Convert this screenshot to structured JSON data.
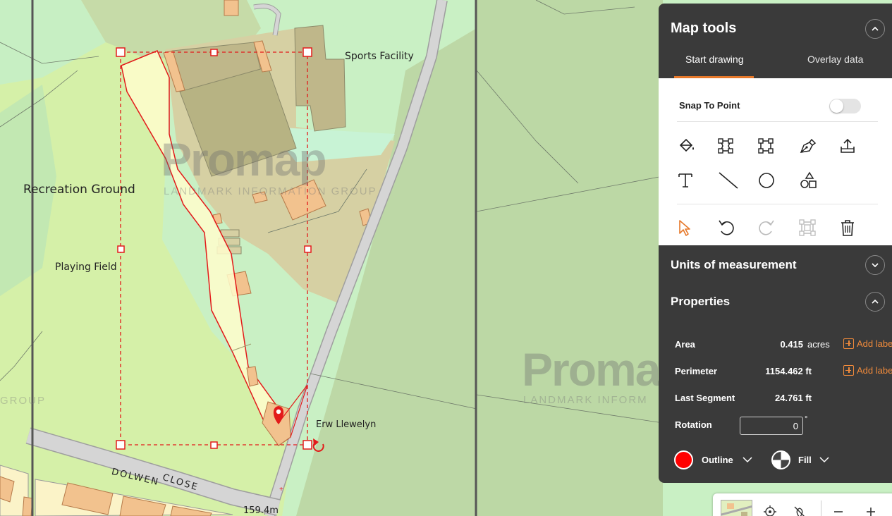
{
  "map": {
    "labels": {
      "recreation_ground": "Recreation Ground",
      "playing_field": "Playing Field",
      "sports_facility": "Sports Facility",
      "erw_llewelyn": "Erw Llewelyn",
      "dolwen": "DOLWEN",
      "close": "CLOSE",
      "spot_height": "159.4m"
    },
    "watermark": {
      "brand": "Promap",
      "tagline": "LANDMARK INFORMATION GROUP",
      "partial_brand": "Promap",
      "partial_tagline": "LANDMARK INFORM",
      "edge_tagline": "GROUP"
    }
  },
  "panel": {
    "title": "Map tools",
    "tabs": [
      {
        "label": "Start drawing",
        "active": true
      },
      {
        "label": "Overlay data",
        "active": false
      }
    ],
    "snap": {
      "label": "Snap To Point",
      "enabled": false
    },
    "tools": {
      "row1": [
        "paint-bucket-icon",
        "polygon-nodes-icon",
        "rectangle-icon",
        "pen-icon",
        "upload-icon"
      ],
      "row2": [
        "text-icon",
        "line-icon",
        "circle-icon",
        "shapes-icon"
      ],
      "row3": [
        "pointer-icon",
        "undo-icon",
        "redo-icon",
        "bounding-box-icon",
        "trash-icon"
      ]
    },
    "units_title": "Units of measurement",
    "properties_title": "Properties",
    "properties": {
      "area": {
        "label": "Area",
        "value": "0.415",
        "unit": "acres",
        "action": "Add label"
      },
      "perimeter": {
        "label": "Perimeter",
        "value": "1154.462 ft",
        "action": "Add label"
      },
      "last_segment": {
        "label": "Last Segment",
        "value": "24.761 ft"
      },
      "rotation": {
        "label": "Rotation",
        "value": "0",
        "degree": "°"
      }
    },
    "style": {
      "outline_label": "Outline",
      "outline_color": "#ff0000",
      "fill_label": "Fill"
    }
  },
  "colors": {
    "accent": "#e6782a",
    "panel_bg": "#3a3a3a",
    "shape_stroke": "#e31a1a"
  }
}
